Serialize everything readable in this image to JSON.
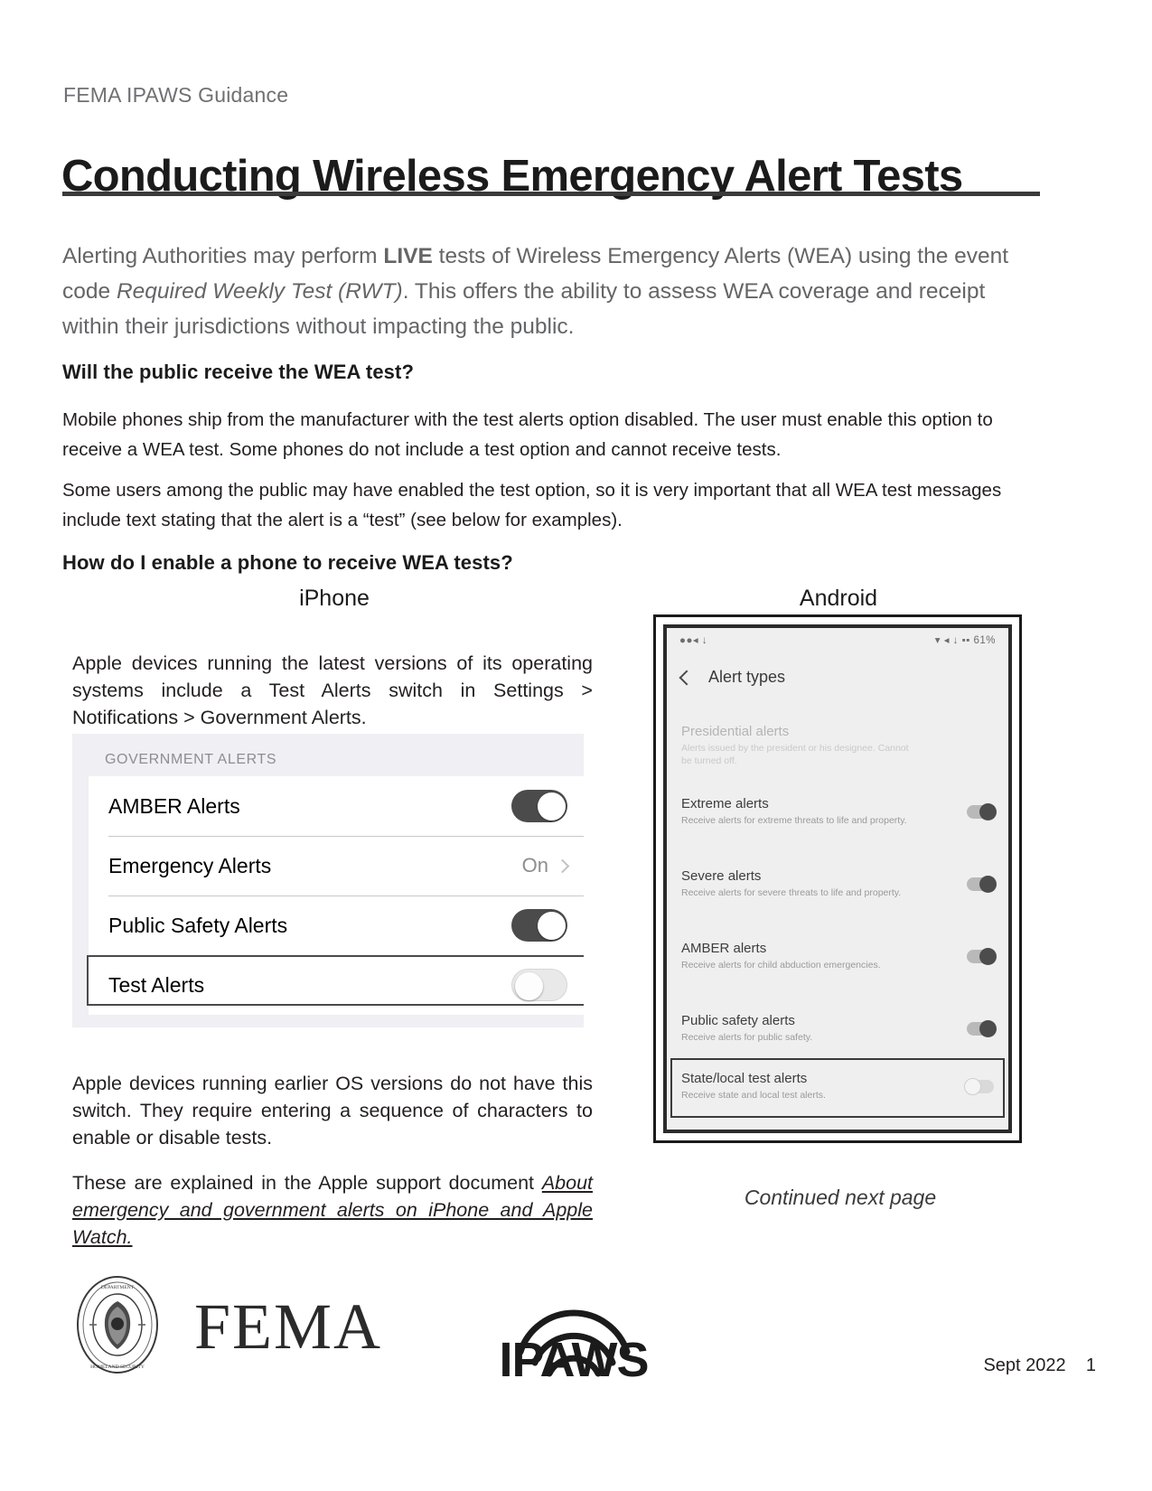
{
  "header": {
    "kicker": "FEMA IPAWS Guidance",
    "title": "Conducting Wireless Emergency Alert Tests"
  },
  "intro": {
    "part1": "Alerting Authorities may perform ",
    "live": "LIVE",
    "part2": " tests of Wireless Emergency Alerts (WEA) using the event code ",
    "italic": "Required Weekly Test (RWT)",
    "part3": ". This offers the ability to assess WEA coverage and receipt within their jurisdictions without impacting the public."
  },
  "sections": {
    "q1": "Will the public receive the WEA test?",
    "p1": "Mobile phones ship from the manufacturer with the test alerts option disabled. The user must enable this option to receive a WEA test. Some phones do not include a test option and cannot receive tests.",
    "p2": "Some users among the public may have enabled the test option, so it is very important that all WEA test messages include text stating that the alert is a “test” (see below for examples).",
    "q2": "How do I enable a phone to receive WEA tests?"
  },
  "columns": {
    "iphone_heading": "iPhone",
    "android_heading": "Android"
  },
  "iphone_column": {
    "para1": "Apple devices running the latest versions of its operating systems include a Test Alerts switch in Settings > Notifications > Government Alerts.",
    "para2": "Apple devices running earlier OS versions do not have this switch. They require entering a sequence of characters to enable or disable tests.",
    "para3_lead": "These are explained in the Apple support document ",
    "para3_link": "About emergency and government alerts on iPhone and Apple Watch."
  },
  "ios_screenshot": {
    "section_title": "GOVERNMENT ALERTS",
    "rows": [
      {
        "label": "AMBER Alerts",
        "control": "toggle",
        "state": "on",
        "value": ""
      },
      {
        "label": "Emergency Alerts",
        "control": "disclosure",
        "state": "",
        "value": "On"
      },
      {
        "label": "Public Safety Alerts",
        "control": "toggle",
        "state": "on",
        "value": ""
      },
      {
        "label": "Test Alerts",
        "control": "toggle",
        "state": "off",
        "value": ""
      }
    ]
  },
  "android_screenshot": {
    "status_left": "●●◂ ↓",
    "status_right": "▾ ◂ ↓ ▪▪ 61%",
    "title": "Alert types",
    "rows": [
      {
        "name": "Presidential alerts",
        "desc": "Alerts issued by the president or his designee. Cannot be turned off.",
        "switch": "",
        "dim": true
      },
      {
        "name": "Extreme alerts",
        "desc": "Receive alerts for extreme threats to life and property.",
        "switch": "on",
        "dim": false
      },
      {
        "name": "Severe alerts",
        "desc": "Receive alerts for severe threats to life and property.",
        "switch": "on",
        "dim": false
      },
      {
        "name": "AMBER alerts",
        "desc": "Receive alerts for child abduction emergencies.",
        "switch": "on",
        "dim": false
      },
      {
        "name": "Public safety alerts",
        "desc": "Receive alerts for public safety.",
        "switch": "on",
        "dim": false
      },
      {
        "name": "State/local test alerts",
        "desc": "Receive state and local test alerts.",
        "switch": "off",
        "dim": false
      }
    ]
  },
  "android_column": {
    "continued": "Continued next page"
  },
  "footer": {
    "fema_wordmark": "FEMA",
    "ipaws_wordmark": "IPAWS",
    "date": "Sept 2022",
    "page_number": "1",
    "pagemark": "Sept 2022    1"
  }
}
